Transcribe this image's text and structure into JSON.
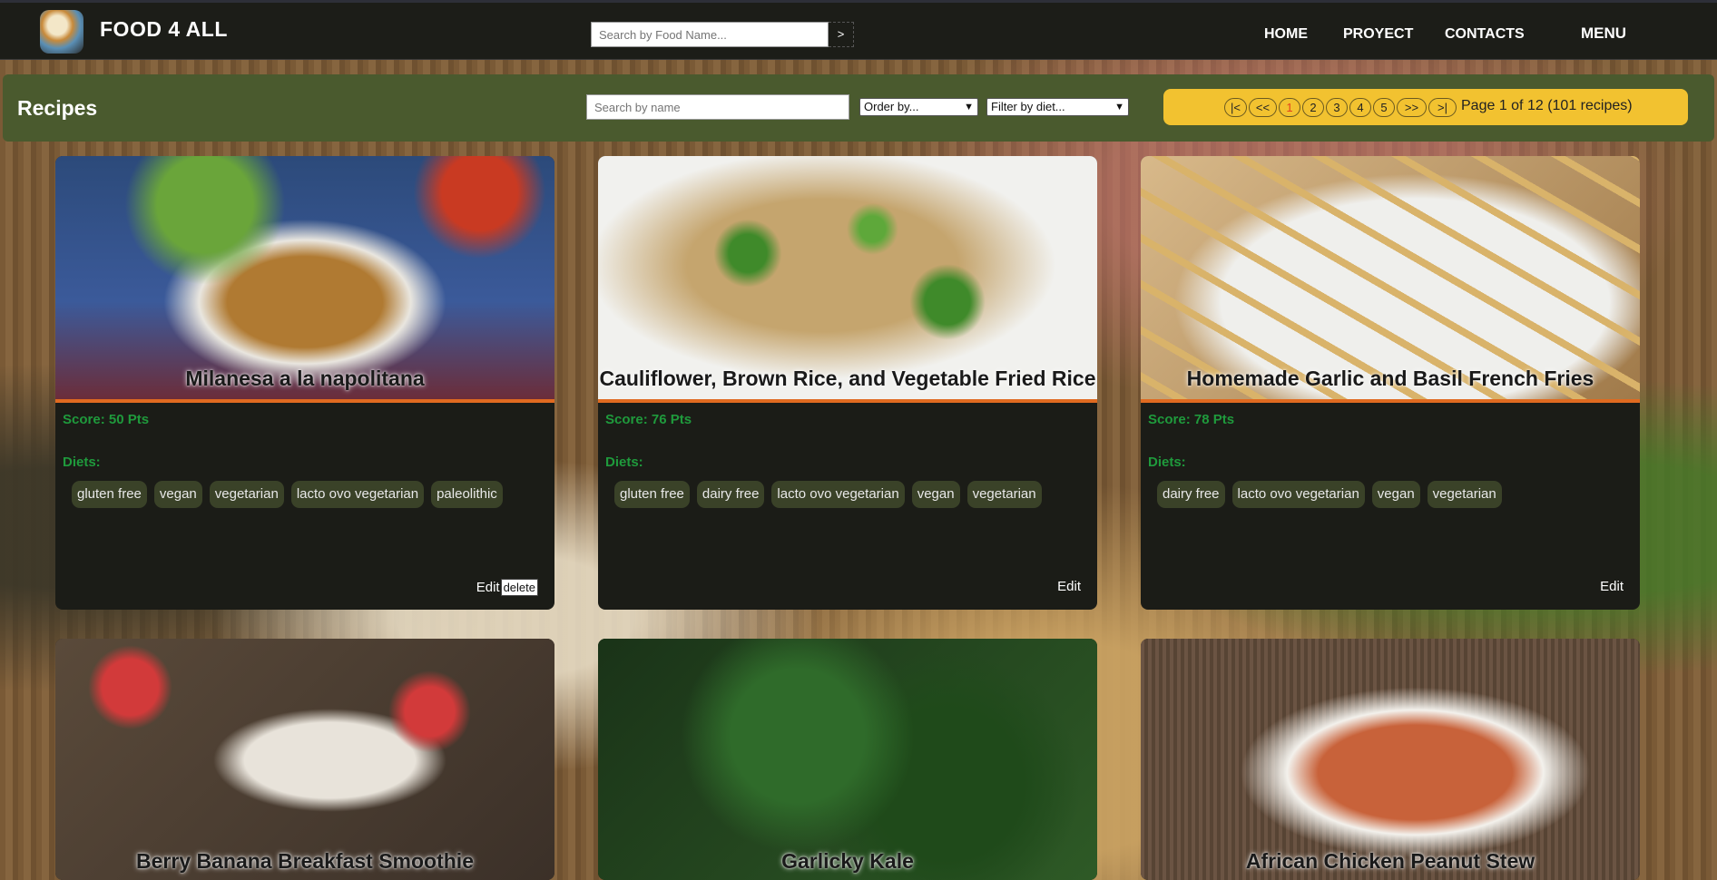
{
  "app": {
    "brand": "FOOD 4 ALL"
  },
  "nav": {
    "search_placeholder": "Search by Food Name...",
    "search_button": ">",
    "links": [
      "HOME",
      "PROYECT",
      "CONTACTS"
    ],
    "menu": "MENU"
  },
  "toolbar": {
    "title": "Recipes",
    "search_placeholder": "Search by name",
    "order_select": "Order by...",
    "diet_select": "Filter by diet...",
    "pager": {
      "first": "|<",
      "prev": "<<",
      "pages": [
        "1",
        "2",
        "3",
        "4",
        "5"
      ],
      "current": "1",
      "next": ">>",
      "last": ">|",
      "info": "Page 1 of 12 (101 recipes)"
    }
  },
  "cards": [
    {
      "title": "Milanesa a la napolitana",
      "score": "Score: 50 Pts",
      "diets_label": "Diets:",
      "diets": [
        "gluten free",
        "vegan",
        "vegetarian",
        "lacto ovo vegetarian",
        "paleolithic"
      ],
      "edit": "Edit",
      "delete": "delete"
    },
    {
      "title": "Cauliflower, Brown Rice, and Vegetable Fried Rice",
      "score": "Score: 76 Pts",
      "diets_label": "Diets:",
      "diets": [
        "gluten free",
        "dairy free",
        "lacto ovo vegetarian",
        "vegan",
        "vegetarian"
      ],
      "edit": "Edit"
    },
    {
      "title": "Homemade Garlic and Basil French Fries",
      "score": "Score: 78 Pts",
      "diets_label": "Diets:",
      "diets": [
        "dairy free",
        "lacto ovo vegetarian",
        "vegan",
        "vegetarian"
      ],
      "edit": "Edit"
    },
    {
      "title": "Berry Banana Breakfast Smoothie"
    },
    {
      "title": "Garlicky Kale"
    },
    {
      "title": "African Chicken Peanut Stew"
    }
  ],
  "colors": {
    "navbar": "#1c1d18",
    "toolbar": "#4a5a2e",
    "pager": "#f2c230",
    "accent_bar": "#e06a20",
    "score_text": "#1f9a3c",
    "card_bg": "#1b1c17"
  }
}
